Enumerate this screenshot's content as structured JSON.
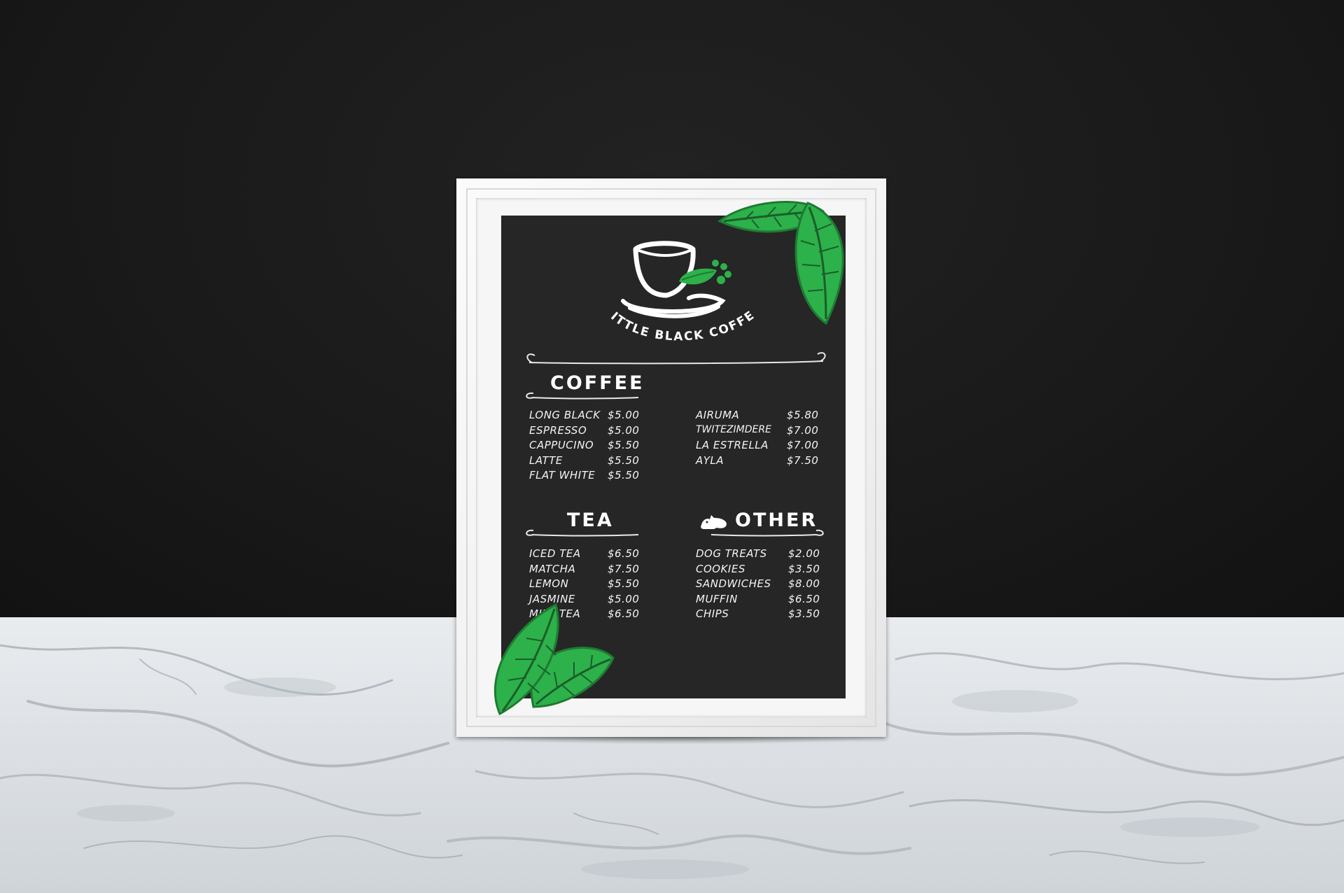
{
  "colors": {
    "wall": "#1a1a1a",
    "board": "#262626",
    "chalk": "#f4f4f4",
    "leaf_green": "#2db14a",
    "leaf_dark": "#1f7a33",
    "frame": "#f4f4f4",
    "marble": "#e2e6ea"
  },
  "logo": {
    "icon": "coffee-cup-leaf-paw-icon",
    "name": "LITTLE BLACK COFFEE"
  },
  "sections": {
    "coffee": {
      "title": "COFFEE",
      "left": [
        {
          "item": "LONG BLACK",
          "price": "$5.00"
        },
        {
          "item": "ESPRESSO",
          "price": "$5.00"
        },
        {
          "item": "CAPPUCINO",
          "price": "$5.50"
        },
        {
          "item": "LATTE",
          "price": "$5.50"
        },
        {
          "item": "FLAT WHITE",
          "price": "$5.50"
        }
      ],
      "right": [
        {
          "item": "AIRUMA",
          "price": "$5.80"
        },
        {
          "item": "TWITEZIMDERE",
          "price": "$7.00"
        },
        {
          "item": "LA ESTRELLA",
          "price": "$7.00"
        },
        {
          "item": "AYLA",
          "price": "$7.50"
        }
      ]
    },
    "tea": {
      "title": "TEA",
      "items": [
        {
          "item": "ICED TEA",
          "price": "$6.50"
        },
        {
          "item": "MATCHA",
          "price": "$7.50"
        },
        {
          "item": "LEMON",
          "price": "$5.50"
        },
        {
          "item": "JASMINE",
          "price": "$5.00"
        },
        {
          "item": "MILK TEA",
          "price": "$6.50"
        }
      ]
    },
    "other": {
      "title": "OTHER",
      "icon": "dog-icon",
      "items": [
        {
          "item": "DOG TREATS",
          "price": "$2.00"
        },
        {
          "item": "COOKIES",
          "price": "$3.50"
        },
        {
          "item": "SANDWICHES",
          "price": "$8.00"
        },
        {
          "item": "MUFFIN",
          "price": "$6.50"
        },
        {
          "item": "CHIPS",
          "price": "$3.50"
        }
      ]
    }
  }
}
